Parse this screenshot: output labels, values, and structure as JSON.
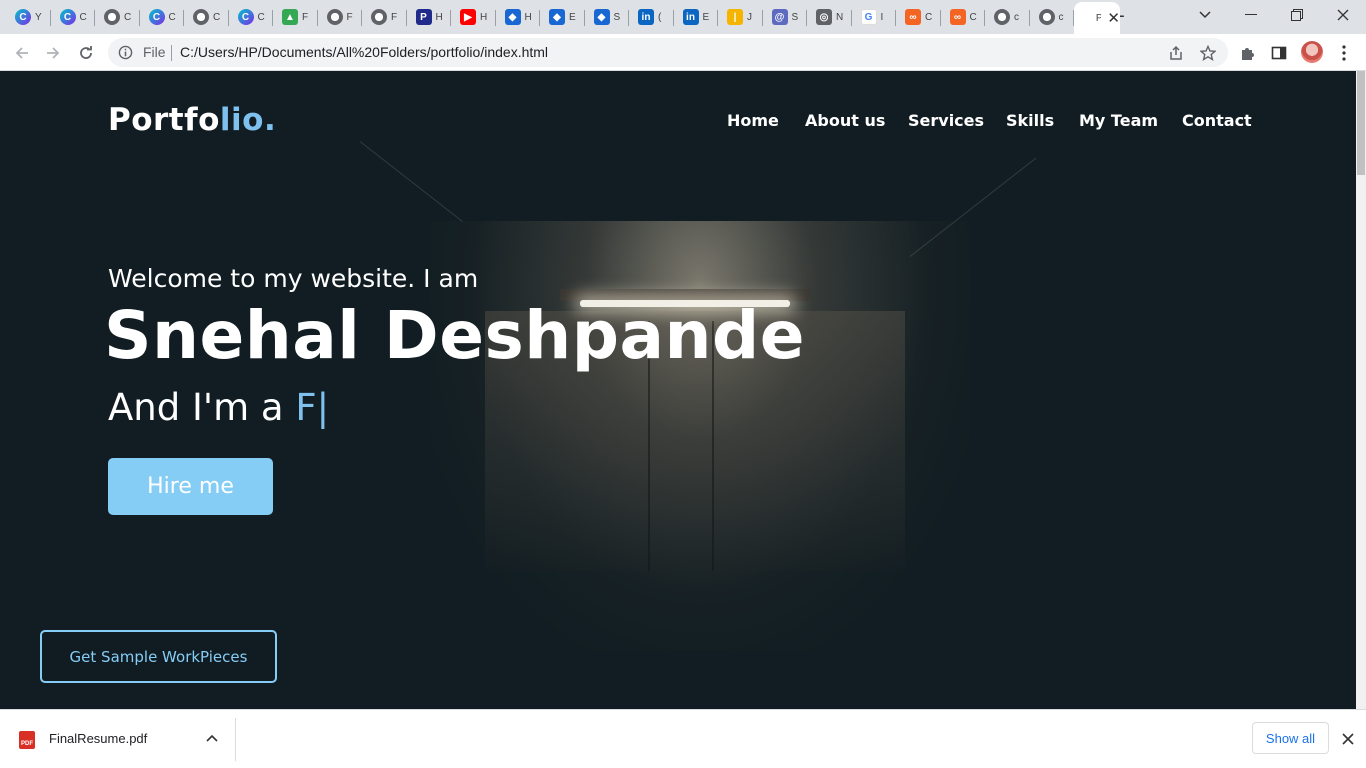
{
  "browser": {
    "tabs": [
      {
        "favicon": "canva-icon",
        "color": "#00a3c4",
        "glyph": "C",
        "title": "Y"
      },
      {
        "favicon": "canva-icon",
        "color": "#00a3c4",
        "glyph": "C",
        "title": "C"
      },
      {
        "favicon": "globe-icon",
        "color": "#5f6368",
        "glyph": "",
        "title": "C"
      },
      {
        "favicon": "canva-icon",
        "color": "#00a3c4",
        "glyph": "C",
        "title": "C"
      },
      {
        "favicon": "globe-icon",
        "color": "#5f6368",
        "glyph": "",
        "title": "C"
      },
      {
        "favicon": "canva-icon",
        "color": "#00a3c4",
        "glyph": "C",
        "title": "C"
      },
      {
        "favicon": "google-drive-icon",
        "color": "#34a853",
        "glyph": "▲",
        "title": "F"
      },
      {
        "favicon": "globe-icon",
        "color": "#5f6368",
        "glyph": "",
        "title": "F"
      },
      {
        "favicon": "globe-icon",
        "color": "#5f6368",
        "glyph": "",
        "title": "F"
      },
      {
        "favicon": "pinterest-icon",
        "color": "#1f2a8a",
        "glyph": "P",
        "title": "H"
      },
      {
        "favicon": "youtube-icon",
        "color": "#ff0000",
        "glyph": "▶",
        "title": "H"
      },
      {
        "favicon": "blue-arrow-icon",
        "color": "#1967d2",
        "glyph": "◆",
        "title": "H"
      },
      {
        "favicon": "blue-arrow-icon",
        "color": "#1967d2",
        "glyph": "◆",
        "title": "E"
      },
      {
        "favicon": "blue-arrow-icon",
        "color": "#1967d2",
        "glyph": "◆",
        "title": "S"
      },
      {
        "favicon": "linkedin-icon",
        "color": "#0a66c2",
        "glyph": "in",
        "title": "("
      },
      {
        "favicon": "linkedin-icon",
        "color": "#0a66c2",
        "glyph": "in",
        "title": "E"
      },
      {
        "favicon": "chart-icon",
        "color": "#f4b400",
        "glyph": "|",
        "title": "J"
      },
      {
        "favicon": "spiral-icon",
        "color": "#5c6bc0",
        "glyph": "@",
        "title": "S"
      },
      {
        "favicon": "chrome-icon",
        "color": "#5f6368",
        "glyph": "◎",
        "title": "N"
      },
      {
        "favicon": "google-icon",
        "color": "#ffffff",
        "glyph": "G",
        "title": "I"
      },
      {
        "favicon": "orange-app-icon",
        "color": "#f46524",
        "glyph": "∞",
        "title": "C"
      },
      {
        "favicon": "orange-app-icon",
        "color": "#f46524",
        "glyph": "∞",
        "title": "C"
      },
      {
        "favicon": "globe-icon",
        "color": "#5f6368",
        "glyph": "",
        "title": "c"
      },
      {
        "favicon": "globe-icon",
        "color": "#5f6368",
        "glyph": "",
        "title": "c"
      },
      {
        "favicon": "page-icon",
        "color": "#ffffff",
        "glyph": "",
        "title": "P",
        "active": true
      }
    ],
    "file_label": "File",
    "url": "C:/Users/HP/Documents/All%20Folders/portfolio/index.html"
  },
  "site": {
    "logo_main": "Portfo",
    "logo_accent": "lio.",
    "nav": [
      "Home",
      "About us",
      "Services",
      "Skills",
      "My Team",
      "Contact"
    ],
    "welcome": "Welcome to my website. I am",
    "name": "Snehal Deshpande",
    "iam_prefix": "And I'm a ",
    "typed_text": "F",
    "caret": "|",
    "hire_button": "Hire me",
    "sample_button": "Get Sample WorkPieces",
    "accent_color": "#7fc1ee",
    "background_color": "#111d22"
  },
  "downloads": {
    "file_name": "FinalResume.pdf",
    "file_type": "PDF",
    "show_all": "Show all"
  }
}
